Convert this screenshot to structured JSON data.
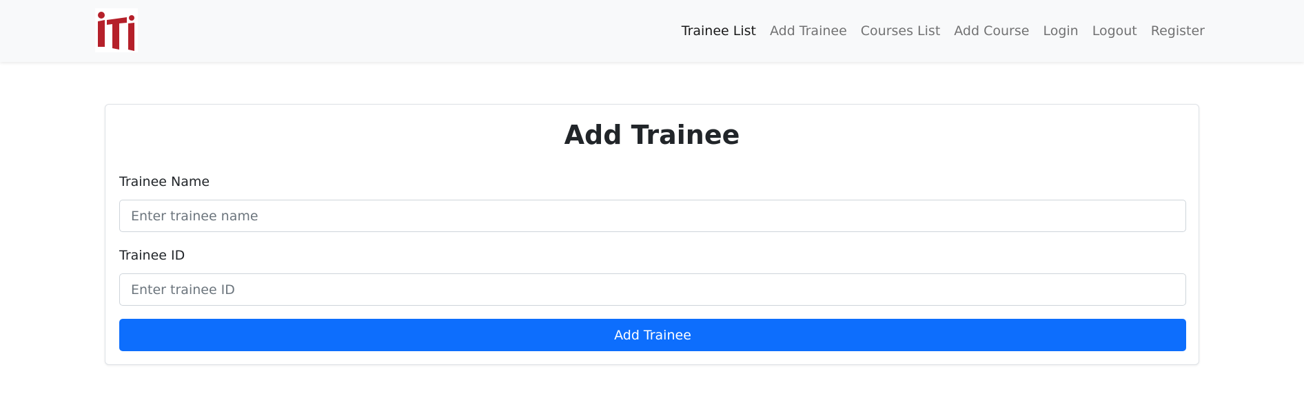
{
  "navbar": {
    "logo": {
      "icon": "iti-logo-icon",
      "text": "iti",
      "color": "#b5202a"
    },
    "links": [
      {
        "label": "Trainee List",
        "active": true
      },
      {
        "label": "Add Trainee",
        "active": false
      },
      {
        "label": "Courses List",
        "active": false
      },
      {
        "label": "Add Course",
        "active": false
      },
      {
        "label": "Login",
        "active": false
      },
      {
        "label": "Logout",
        "active": false
      },
      {
        "label": "Register",
        "active": false
      }
    ]
  },
  "form": {
    "title": "Add Trainee",
    "fields": [
      {
        "label": "Trainee Name",
        "value": "",
        "placeholder": "Enter trainee name"
      },
      {
        "label": "Trainee ID",
        "value": "",
        "placeholder": "Enter trainee ID"
      }
    ],
    "submit_label": "Add Trainee"
  },
  "colors": {
    "primary": "#0d6efd",
    "navbar_bg": "#f8f9fa",
    "text": "#212529"
  }
}
